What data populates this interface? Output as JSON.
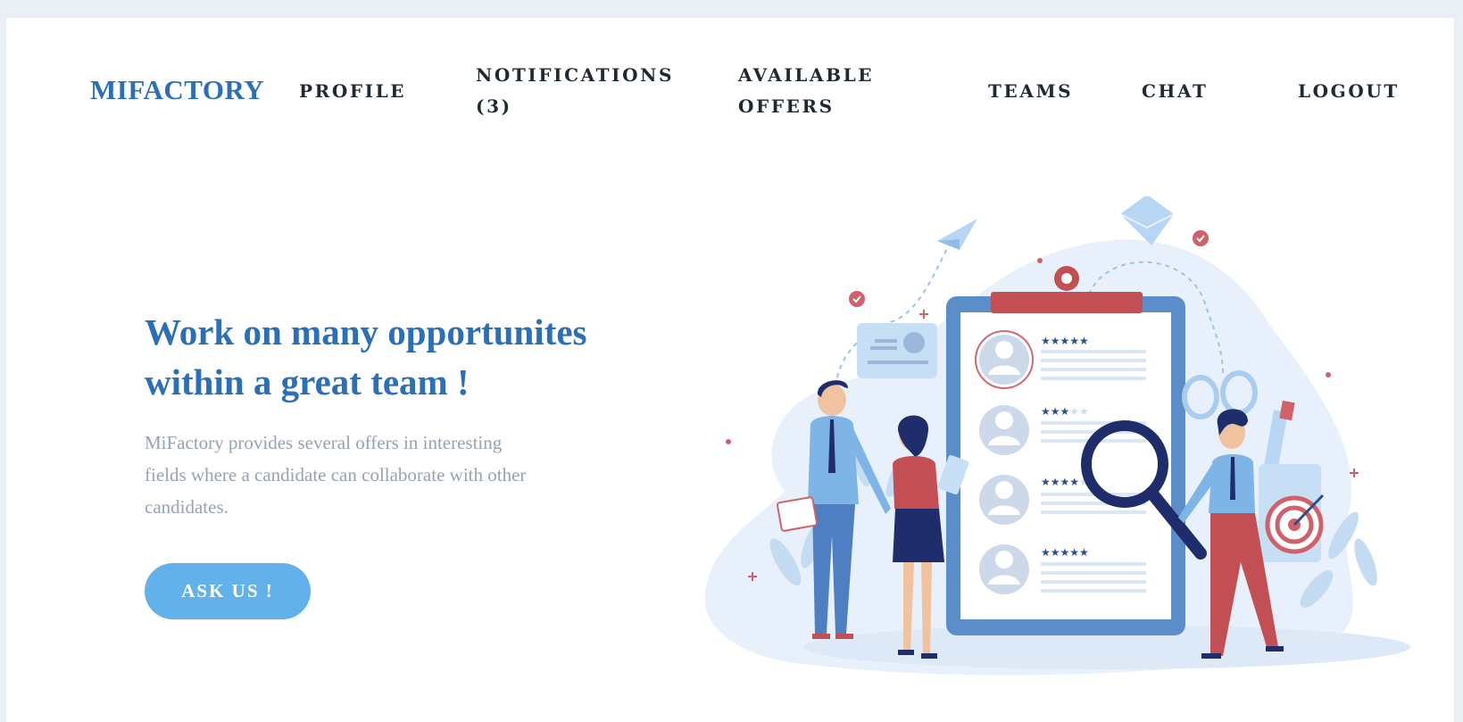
{
  "nav": {
    "brand": "MIFACTORY",
    "links": [
      "PROFILE",
      "NOTIFICATIONS (3)",
      "AVAILABLE OFFERS",
      "TEAMS",
      "CHAT",
      "LOGOUT"
    ]
  },
  "hero": {
    "title": "Work on many opportunites within a great team !",
    "description": "MiFactory provides several offers in interesting fields where a candidate can collaborate with other candidates.",
    "button_label": "ASK US !"
  },
  "illustration": {
    "icon": "recruitment-illustration",
    "ratings": [
      5,
      3,
      4,
      5
    ]
  },
  "colors": {
    "brand": "#2a6fb8",
    "button": "#63b1ea",
    "muted_text": "#96a3b3",
    "nav_text": "#1f2a30",
    "accent_red": "#c24f54"
  }
}
